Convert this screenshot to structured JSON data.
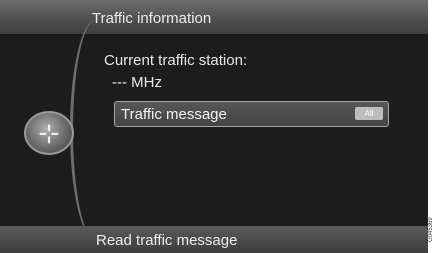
{
  "header": {
    "title": "Traffic information"
  },
  "station": {
    "label": "Current traffic station:",
    "value": "--- MHz"
  },
  "knob": {
    "icon": "traffic-knob-icon",
    "glyph": "⊹"
  },
  "menu": {
    "items": [
      {
        "label": "Traffic message",
        "toggle_text": "All"
      }
    ]
  },
  "footer": {
    "label": "Read traffic message"
  },
  "image_code": "G045369"
}
